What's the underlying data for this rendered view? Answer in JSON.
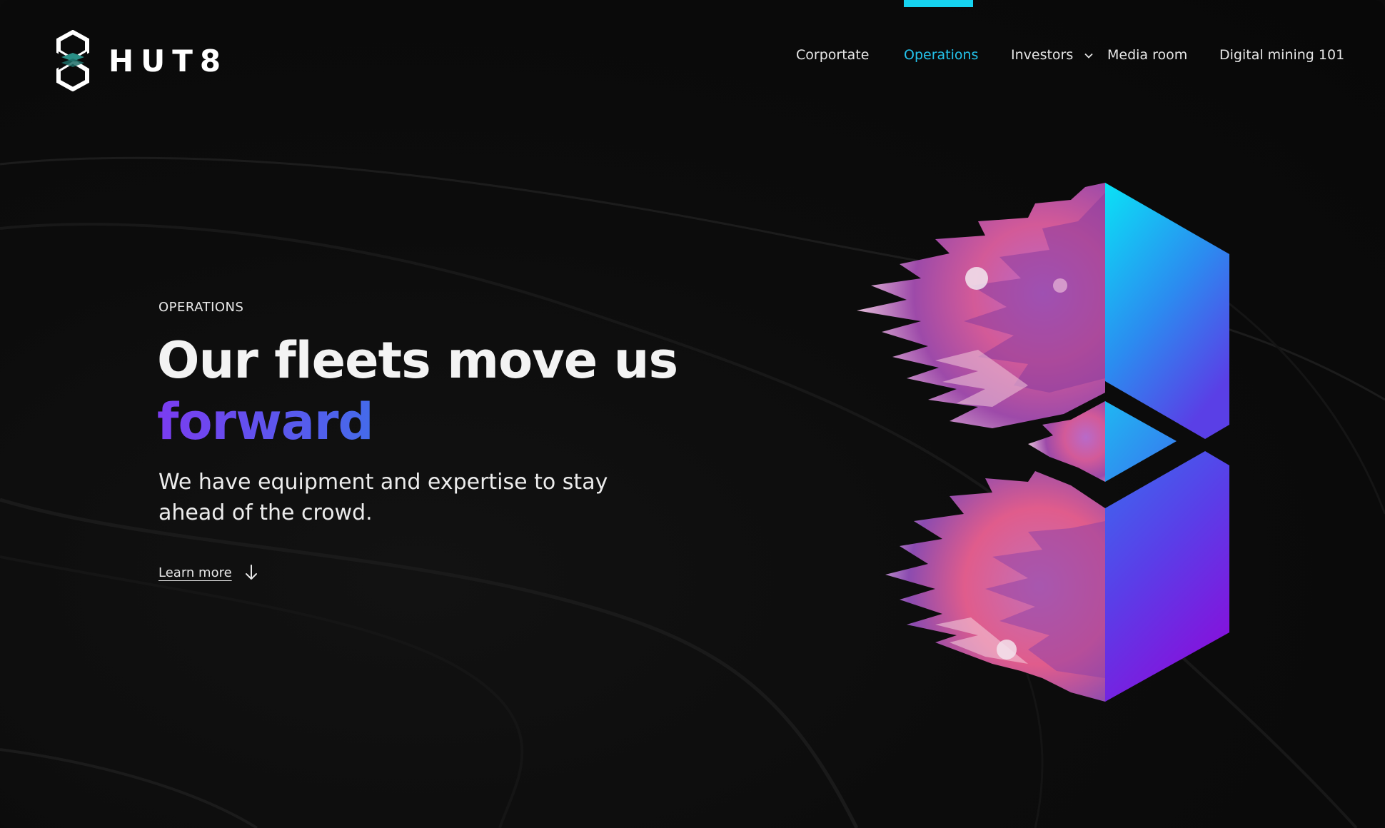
{
  "brand": {
    "name": "HUT8",
    "logo_icon": "hexagon-8-logo-icon"
  },
  "nav": {
    "items": [
      {
        "label": "Corportate",
        "active": false
      },
      {
        "label": "Operations",
        "active": true
      },
      {
        "label": "Investors",
        "active": false,
        "has_dropdown": true
      },
      {
        "label": "Media room",
        "active": false
      },
      {
        "label": "Digital mining 101",
        "active": false
      }
    ],
    "active_color": "#16d3f0",
    "dropdown_icon": "chevron-down-icon"
  },
  "hero": {
    "eyebrow": "OPERATIONS",
    "headline_line1": "Our fleets move us",
    "headline_accent": "forward",
    "subtext": "We have equipment and expertise to stay ahead of the crowd.",
    "cta_label": "Learn more",
    "cta_icon": "arrow-down-icon",
    "graphic": "hexagon-8-coral-graphic"
  },
  "colors": {
    "background": "#0b0b0b",
    "accent_cyan": "#16d3f0",
    "accent_blue": "#3f6fea",
    "accent_purple": "#7b3cf0"
  }
}
